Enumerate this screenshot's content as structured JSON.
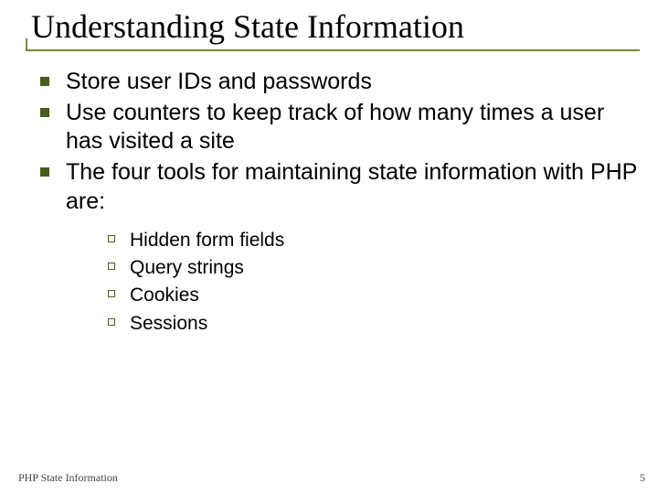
{
  "title": "Understanding State Information",
  "bullets": [
    {
      "text": "Store user IDs and passwords"
    },
    {
      "text": "Use counters to keep track of how many times a user has visited a site"
    },
    {
      "text": "The four tools for maintaining state information with PHP are:"
    }
  ],
  "sub_bullets": [
    {
      "text": "Hidden form fields"
    },
    {
      "text": "Query strings"
    },
    {
      "text": "Cookies"
    },
    {
      "text": "Sessions"
    }
  ],
  "footer": "PHP State Information",
  "page_number": "5",
  "colors": {
    "accent": "#7a8a3a",
    "bullet": "#4a5b1e"
  }
}
